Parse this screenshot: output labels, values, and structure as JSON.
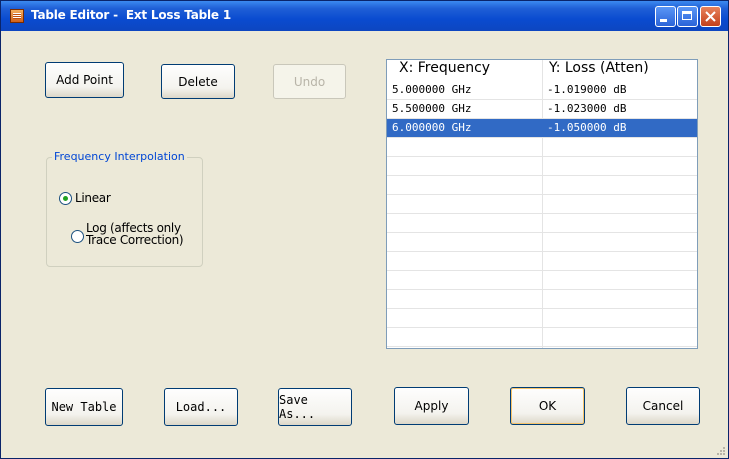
{
  "window": {
    "title": "Table Editor -  Ext Loss Table 1",
    "colors": {
      "titlebar": "#0a4bd0",
      "face": "#ece9d8",
      "selection": "#316ac5",
      "group_legend": "#0046d5"
    }
  },
  "titlebar_buttons": {
    "minimize": "minimize-icon",
    "maximize": "maximize-icon",
    "close": "close-icon"
  },
  "edit_buttons": {
    "add_point": "Add Point",
    "delete": "Delete",
    "undo": "Undo"
  },
  "interpolation": {
    "legend": "Frequency Interpolation",
    "linear": "Linear",
    "log_line1": "Log (affects only",
    "log_line2": "Trace Correction)",
    "selected": "Linear"
  },
  "table": {
    "headers": [
      "X: Frequency",
      "Y: Loss (Atten)"
    ],
    "rows": [
      [
        "5.000000 GHz",
        "-1.019000 dB"
      ],
      [
        "5.500000 GHz",
        "-1.023000 dB"
      ],
      [
        "6.000000 GHz",
        "-1.050000 dB"
      ]
    ],
    "selected_row": 2
  },
  "bottom_buttons": {
    "new_table": "New Table",
    "load": "Load...",
    "save_as": "Save As...",
    "apply": "Apply",
    "ok": "OK",
    "cancel": "Cancel"
  }
}
